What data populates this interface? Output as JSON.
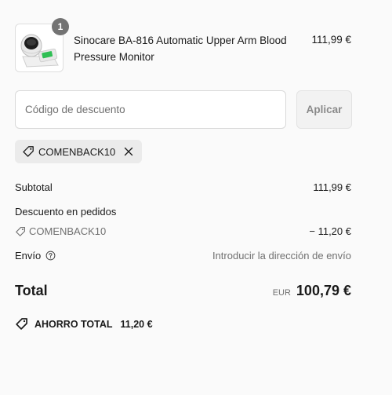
{
  "product": {
    "name": "Sinocare BA-816 Automatic Upper Arm Blood Pressure Monitor",
    "price": "111,99 €",
    "quantity": "1",
    "image": "blood-pressure-monitor"
  },
  "discount": {
    "placeholder": "Código de descuento",
    "apply_label": "Aplicar",
    "applied_code": "COMENBACK10"
  },
  "summary": {
    "subtotal_label": "Subtotal",
    "subtotal_value": "111,99 €",
    "order_discount_label": "Descuento en pedidos",
    "discount_code": "COMENBACK10",
    "discount_value": "− 11,20 €",
    "shipping_label": "Envío",
    "shipping_value": "Introducir la dirección de envío",
    "total_label": "Total",
    "currency": "EUR",
    "total_value": "100,79 €",
    "savings_label": "AHORRO TOTAL",
    "savings_value": "11,20 €"
  },
  "icons": [
    "tag-icon",
    "close-icon",
    "help-circle-icon"
  ]
}
